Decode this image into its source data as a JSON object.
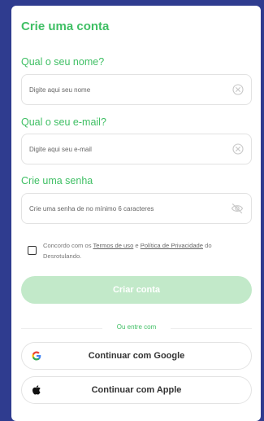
{
  "form": {
    "title": "Crie uma conta",
    "name": {
      "label": "Qual o seu nome?",
      "placeholder": "Digite aqui seu nome"
    },
    "email": {
      "label": "Qual o seu e-mail?",
      "placeholder": "Digite aqui seu e-mail"
    },
    "password": {
      "label": "Crie uma senha",
      "placeholder": "Crie uma senha de no mínimo 6 caracteres"
    },
    "terms": {
      "prefix": "Concordo com os ",
      "terms_link": "Termos de uso",
      "middle": " e ",
      "privacy_link": "Política de Privacidade",
      "suffix": " do Desrotulando.",
      "checked": false
    },
    "submit_label": "Criar conta",
    "divider_text": "Ou entre com",
    "google_label": "Continuar com Google",
    "apple_label": "Continuar com Apple"
  },
  "colors": {
    "accent": "#3fbf64",
    "button_disabled": "#c2e9c9",
    "background": "#2f3c8f"
  },
  "icons": {
    "name_clear": "clear-circle-icon",
    "email_clear": "clear-circle-icon",
    "password_toggle": "eye-off-icon",
    "google": "google-icon",
    "apple": "apple-icon"
  }
}
